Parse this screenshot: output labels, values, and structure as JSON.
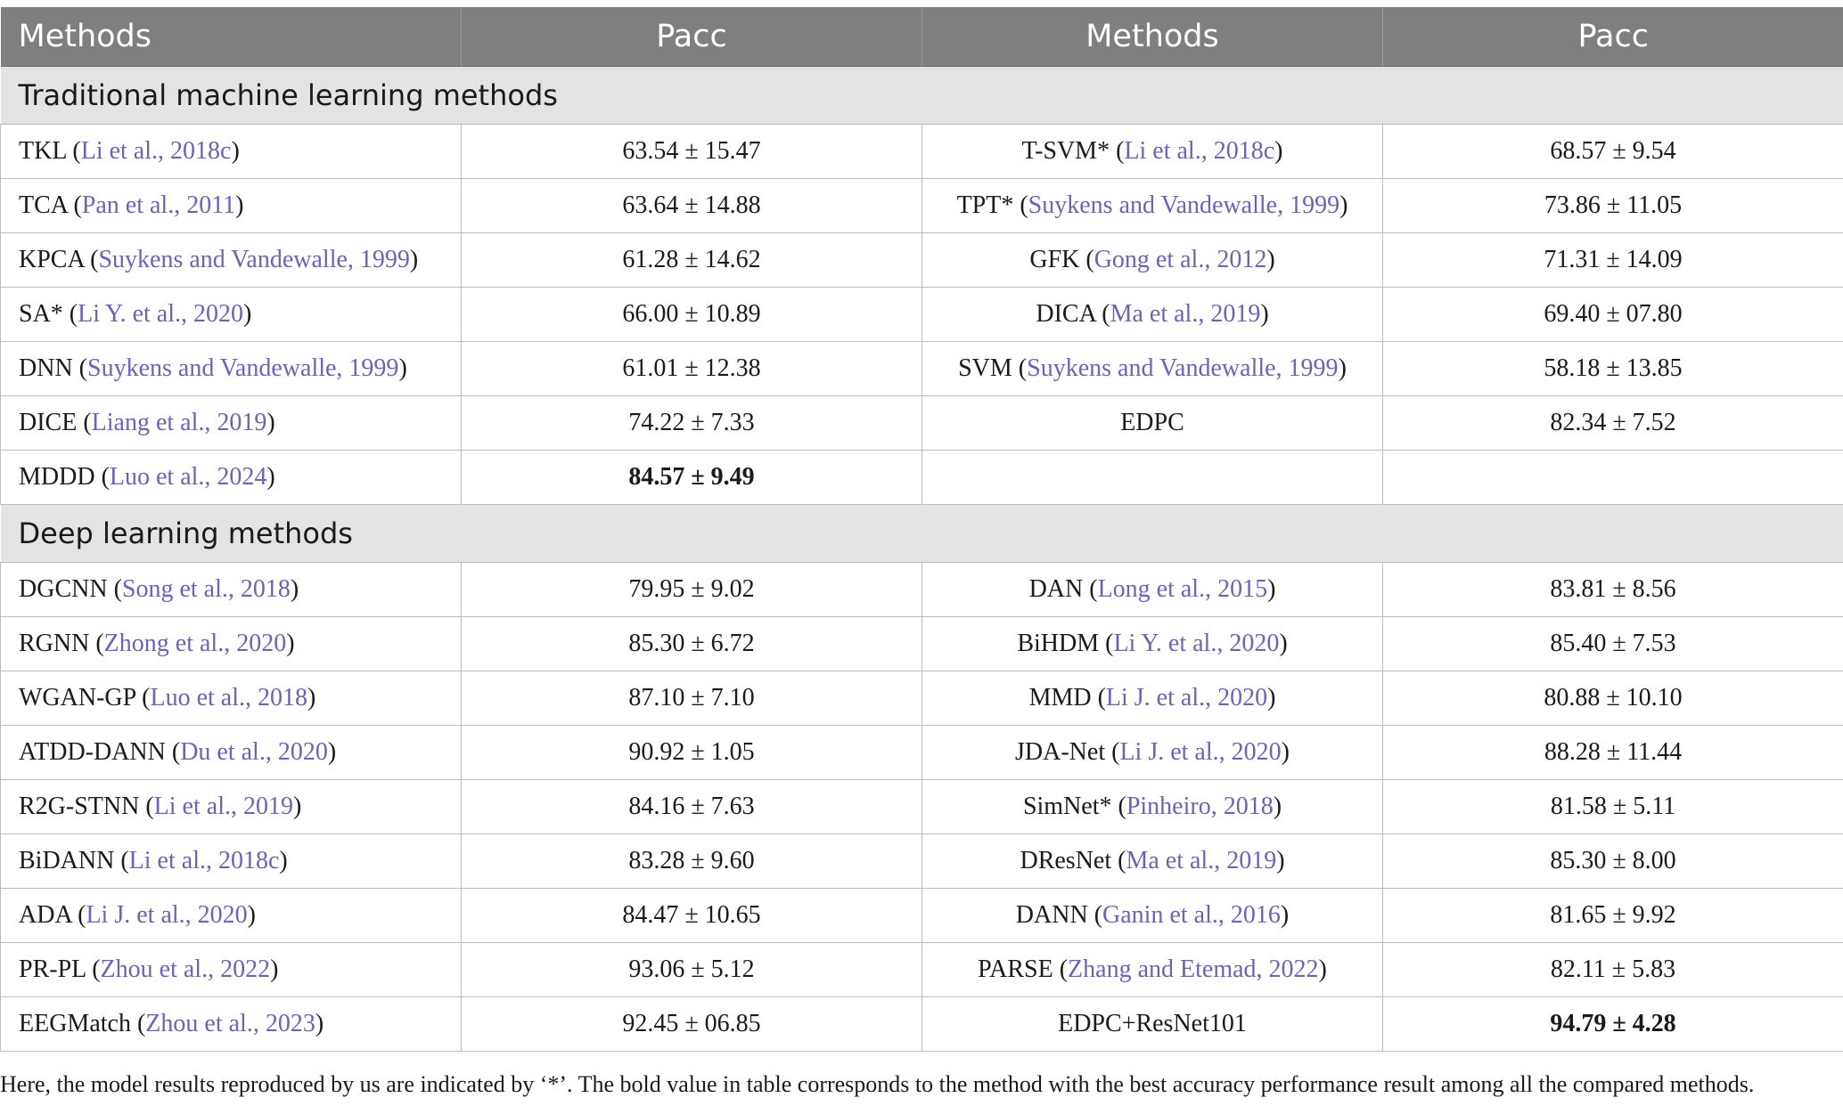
{
  "table": {
    "headers": [
      "Methods",
      "Pacc",
      "Methods",
      "Pacc"
    ],
    "sections": [
      {
        "title": "Traditional machine learning methods",
        "rows": [
          {
            "left": {
              "name": "TKL",
              "ref": "Li et al., 2018c",
              "pacc": "63.54 ± 15.47",
              "bold": false
            },
            "right": {
              "name": "T-SVM*",
              "ref": "Li et al., 2018c",
              "pacc": "68.57 ± 9.54",
              "bold": false
            }
          },
          {
            "left": {
              "name": "TCA",
              "ref": "Pan et al., 2011",
              "pacc": "63.64 ± 14.88",
              "bold": false
            },
            "right": {
              "name": "TPT*",
              "ref": "Suykens and Vandewalle, 1999",
              "pacc": "73.86 ± 11.05",
              "bold": false
            }
          },
          {
            "left": {
              "name": "KPCA",
              "ref": "Suykens and Vandewalle, 1999",
              "pacc": "61.28 ± 14.62",
              "bold": false
            },
            "right": {
              "name": "GFK",
              "ref": "Gong et al., 2012",
              "pacc": "71.31 ± 14.09",
              "bold": false
            }
          },
          {
            "left": {
              "name": "SA*",
              "ref": "Li Y. et al., 2020",
              "pacc": "66.00 ± 10.89",
              "bold": false
            },
            "right": {
              "name": "DICA",
              "ref": "Ma et al., 2019",
              "pacc": "69.40 ± 07.80",
              "bold": false
            }
          },
          {
            "left": {
              "name": "DNN",
              "ref": "Suykens and Vandewalle, 1999",
              "pacc": "61.01 ± 12.38",
              "bold": false
            },
            "right": {
              "name": "SVM",
              "ref": "Suykens and Vandewalle, 1999",
              "pacc": "58.18 ± 13.85",
              "bold": false
            }
          },
          {
            "left": {
              "name": "DICE",
              "ref": "Liang et al., 2019",
              "pacc": "74.22 ± 7.33",
              "bold": false
            },
            "right": {
              "name": "EDPC",
              "ref": "",
              "pacc": "82.34 ± 7.52",
              "bold": false
            }
          },
          {
            "left": {
              "name": "MDDD",
              "ref": "Luo et al., 2024",
              "pacc": "84.57 ± 9.49",
              "bold": true
            },
            "right": {
              "name": "",
              "ref": "",
              "pacc": "",
              "bold": false
            }
          }
        ]
      },
      {
        "title": "Deep learning methods",
        "rows": [
          {
            "left": {
              "name": "DGCNN",
              "ref": "Song et al., 2018",
              "pacc": "79.95 ± 9.02",
              "bold": false
            },
            "right": {
              "name": "DAN",
              "ref": "Long et al., 2015",
              "pacc": "83.81 ± 8.56",
              "bold": false
            }
          },
          {
            "left": {
              "name": "RGNN",
              "ref": "Zhong et al., 2020",
              "pacc": "85.30 ± 6.72",
              "bold": false
            },
            "right": {
              "name": "BiHDM",
              "ref": "Li Y. et al., 2020",
              "pacc": "85.40 ± 7.53",
              "bold": false
            }
          },
          {
            "left": {
              "name": "WGAN-GP",
              "ref": "Luo et al., 2018",
              "pacc": "87.10 ± 7.10",
              "bold": false
            },
            "right": {
              "name": "MMD",
              "ref": "Li J. et al., 2020",
              "pacc": "80.88 ± 10.10",
              "bold": false
            }
          },
          {
            "left": {
              "name": "ATDD-DANN",
              "ref": "Du et al., 2020",
              "pacc": "90.92 ± 1.05",
              "bold": false
            },
            "right": {
              "name": "JDA-Net",
              "ref": "Li J. et al., 2020",
              "pacc": "88.28 ± 11.44",
              "bold": false
            }
          },
          {
            "left": {
              "name": "R2G-STNN",
              "ref": "Li et al., 2019",
              "pacc": "84.16 ± 7.63",
              "bold": false
            },
            "right": {
              "name": "SimNet*",
              "ref": "Pinheiro, 2018",
              "pacc": "81.58 ± 5.11",
              "bold": false
            }
          },
          {
            "left": {
              "name": "BiDANN",
              "ref": "Li et al., 2018c",
              "pacc": "83.28 ± 9.60",
              "bold": false
            },
            "right": {
              "name": "DResNet",
              "ref": "Ma et al., 2019",
              "pacc": "85.30 ± 8.00",
              "bold": false
            }
          },
          {
            "left": {
              "name": "ADA",
              "ref": "Li J. et al., 2020",
              "pacc": "84.47 ± 10.65",
              "bold": false
            },
            "right": {
              "name": "DANN",
              "ref": "Ganin et al., 2016",
              "pacc": "81.65 ± 9.92",
              "bold": false
            }
          },
          {
            "left": {
              "name": "PR-PL",
              "ref": "Zhou et al., 2022",
              "pacc": "93.06 ± 5.12",
              "bold": false
            },
            "right": {
              "name": "PARSE",
              "ref": "Zhang and Etemad, 2022",
              "pacc": "82.11 ± 5.83",
              "bold": false
            }
          },
          {
            "left": {
              "name": "EEGMatch",
              "ref": "Zhou et al., 2023",
              "pacc": "92.45 ± 06.85",
              "bold": false
            },
            "right": {
              "name": "EDPC+ResNet101",
              "ref": "",
              "pacc": "94.79 ± 4.28",
              "bold": true
            }
          }
        ]
      }
    ]
  },
  "footnote": "Here, the model results reproduced by us are indicated by ‘*’. The bold value in table corresponds to the method with the best accuracy performance result among all the compared methods."
}
